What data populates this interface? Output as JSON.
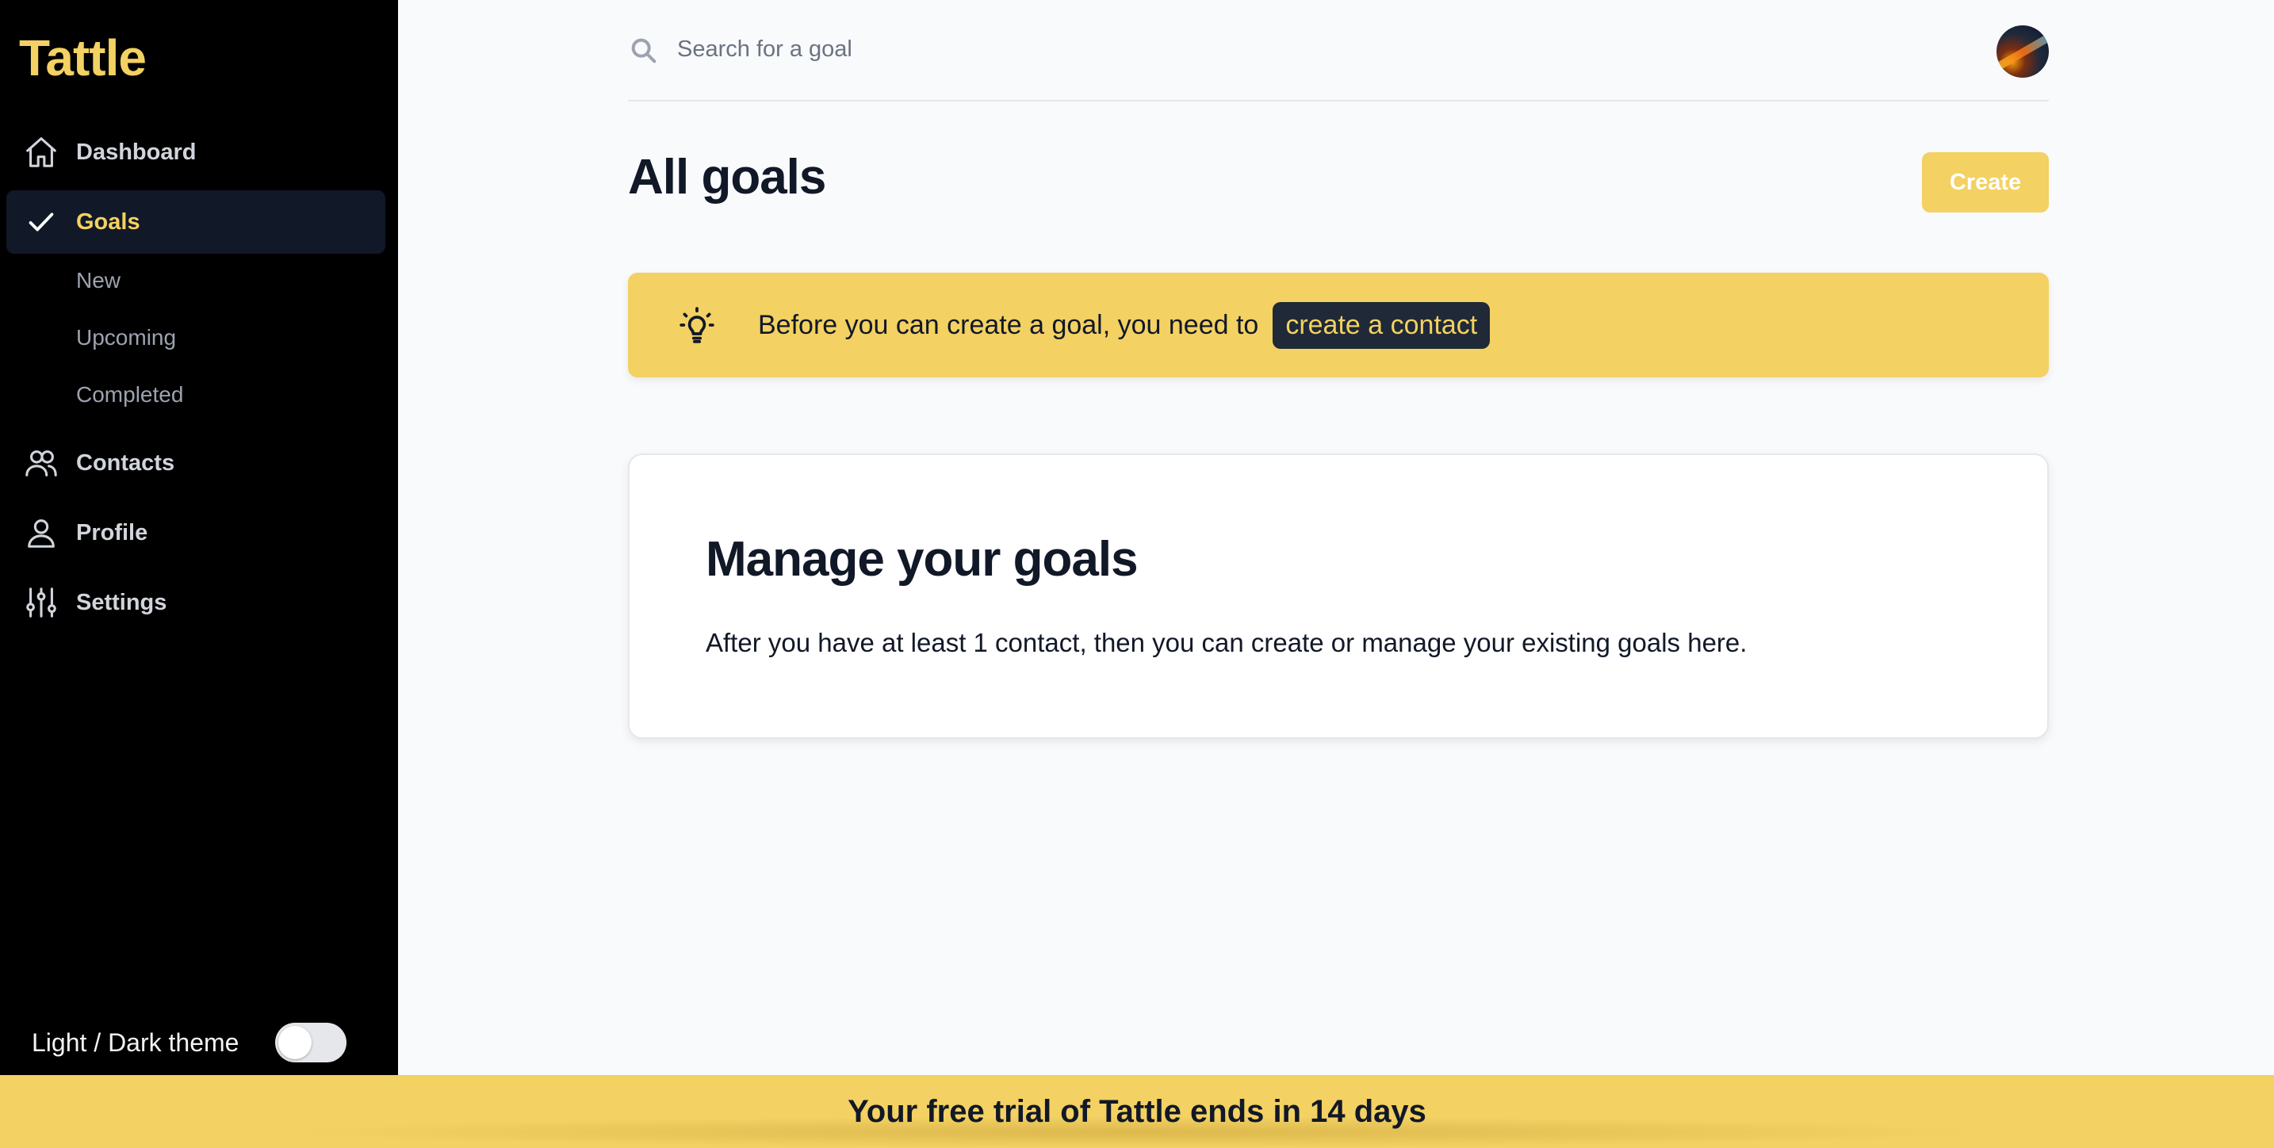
{
  "app": {
    "name": "Tattle"
  },
  "sidebar": {
    "items": [
      {
        "label": "Dashboard",
        "icon": "home-icon"
      },
      {
        "label": "Goals",
        "icon": "check-icon",
        "active": true
      },
      {
        "label": "Contacts",
        "icon": "users-icon"
      },
      {
        "label": "Profile",
        "icon": "user-icon"
      },
      {
        "label": "Settings",
        "icon": "sliders-icon"
      }
    ],
    "goals_subitems": [
      "New",
      "Upcoming",
      "Completed"
    ],
    "theme_toggle": {
      "label": "Light / Dark theme",
      "on": false
    }
  },
  "search": {
    "placeholder": "Search for a goal"
  },
  "main": {
    "title": "All goals",
    "create_label": "Create",
    "alert": {
      "text": "Before you can create a goal, you need to",
      "link_label": "create a contact",
      "icon": "lightbulb-icon"
    },
    "card": {
      "heading": "Manage your goals",
      "body": "After you have at least 1 contact, then you can create or manage your existing goals here."
    }
  },
  "trial_banner": {
    "text": "Your free trial of Tattle ends in 14 days"
  },
  "colors": {
    "accent": "#f3d162",
    "sidebar_bg": "#000000",
    "active_bg": "#111827"
  }
}
